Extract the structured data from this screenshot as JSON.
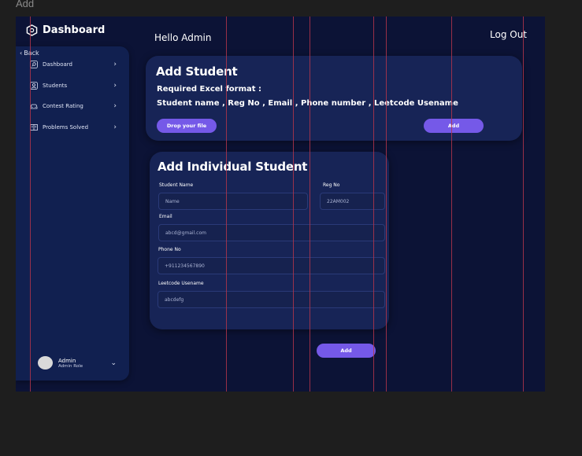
{
  "canvas_label": "Add",
  "brand": {
    "title": "Dashboard"
  },
  "sidebar": {
    "back_label": "Back",
    "items": [
      {
        "label": "Dashboard"
      },
      {
        "label": "Students"
      },
      {
        "label": "Contest Rating"
      },
      {
        "label": "Problems Solved"
      }
    ],
    "user": {
      "name": "Admin",
      "role": "Admin Role"
    }
  },
  "header": {
    "greeting": "Hello Admin",
    "logout_label": "Log Out"
  },
  "upload_card": {
    "title": "Add Student",
    "format_heading": "Required Excel format :",
    "format_fields": "Student name , Reg No , Email , Phone number , Leetcode  Usename",
    "drop_label": "Drop your file",
    "add_label": "Add"
  },
  "individual_card": {
    "title": "Add Individual Student",
    "student_name": {
      "label": "Student Name",
      "value": "Name"
    },
    "reg_no": {
      "label": "Reg No",
      "value": "22AM002"
    },
    "email": {
      "label": "Email",
      "value": "abcd@gmail.com"
    },
    "phone": {
      "label": "Phone No",
      "value": "+911234567890"
    },
    "leetcode": {
      "label": "Leetcode Usename",
      "value": "abcdefg"
    }
  },
  "submit_label": "Add",
  "colors": {
    "background": "#0c1336",
    "sidebar": "#112050",
    "card": "#172456",
    "accent": "#7559e8",
    "guide": "#b2354a"
  }
}
